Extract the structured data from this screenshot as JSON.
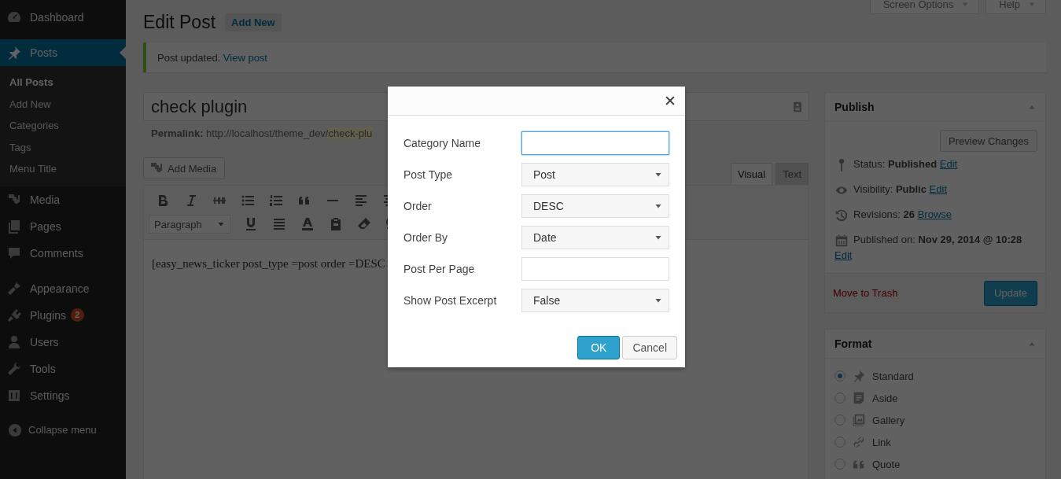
{
  "sidebar": {
    "items": [
      {
        "label": "Dashboard",
        "selected": false
      },
      {
        "label": "Posts",
        "selected": true,
        "children": [
          {
            "label": "All Posts",
            "selected": true
          },
          {
            "label": "Add New",
            "selected": false
          },
          {
            "label": "Categories",
            "selected": false
          },
          {
            "label": "Tags",
            "selected": false
          },
          {
            "label": "Menu Title",
            "selected": false
          }
        ]
      },
      {
        "label": "Media",
        "selected": false
      },
      {
        "label": "Pages",
        "selected": false
      },
      {
        "label": "Comments",
        "selected": false
      },
      {
        "label": "Appearance",
        "selected": false
      },
      {
        "label": "Plugins",
        "selected": false,
        "badge": "2"
      },
      {
        "label": "Users",
        "selected": false
      },
      {
        "label": "Tools",
        "selected": false
      },
      {
        "label": "Settings",
        "selected": false
      }
    ],
    "collapse": "Collapse menu"
  },
  "screen_tabs": [
    "Screen Options",
    "Help"
  ],
  "page": {
    "title": "Edit Post",
    "add_new": "Add New"
  },
  "notice": {
    "text": "Post updated.",
    "link": "View post"
  },
  "post": {
    "title": "check plugin",
    "permalink_label": "Permalink:",
    "permalink_url": "http://localhost/theme_dev/",
    "permalink_slug": "check-plu"
  },
  "editor": {
    "add_media": "Add Media",
    "tabs": [
      {
        "label": "Visual",
        "selected": true
      },
      {
        "label": "Text",
        "selected": false
      }
    ],
    "format": "Paragraph",
    "content": "[easy_news_ticker post_type =post order =DESC"
  },
  "publish": {
    "title": "Publish",
    "preview": "Preview Changes",
    "rows": [
      {
        "text": "Status: **Published**",
        "link": "Edit"
      },
      {
        "text": "Visibility: **Public**",
        "link": "Edit"
      },
      {
        "text": "Revisions: **26**",
        "link": "Browse"
      },
      {
        "text": "Published on: **Nov 29, 2014 @ 10:28**",
        "link": "Edit"
      }
    ],
    "trash": "Move to Trash",
    "update": "Update"
  },
  "format": {
    "title": "Format",
    "options": [
      {
        "label": "Standard",
        "selected": true
      },
      {
        "label": "Aside",
        "selected": false
      },
      {
        "label": "Gallery",
        "selected": false
      },
      {
        "label": "Link",
        "selected": false
      },
      {
        "label": "Quote",
        "selected": false
      }
    ]
  },
  "dialog": {
    "fields": [
      {
        "label": "Category Name",
        "kind": "text",
        "focused": true
      },
      {
        "label": "Post Type",
        "kind": "select",
        "value": "Post",
        "focused": false
      },
      {
        "label": "Order",
        "kind": "select",
        "value": "DESC",
        "focused": false
      },
      {
        "label": "Order By",
        "kind": "select",
        "value": "Date",
        "focused": false
      },
      {
        "label": "Post Per Page",
        "kind": "text",
        "focused": false
      },
      {
        "label": "Show Post Excerpt",
        "kind": "select",
        "value": "False",
        "focused": false
      }
    ],
    "ok": "OK",
    "cancel": "Cancel"
  }
}
